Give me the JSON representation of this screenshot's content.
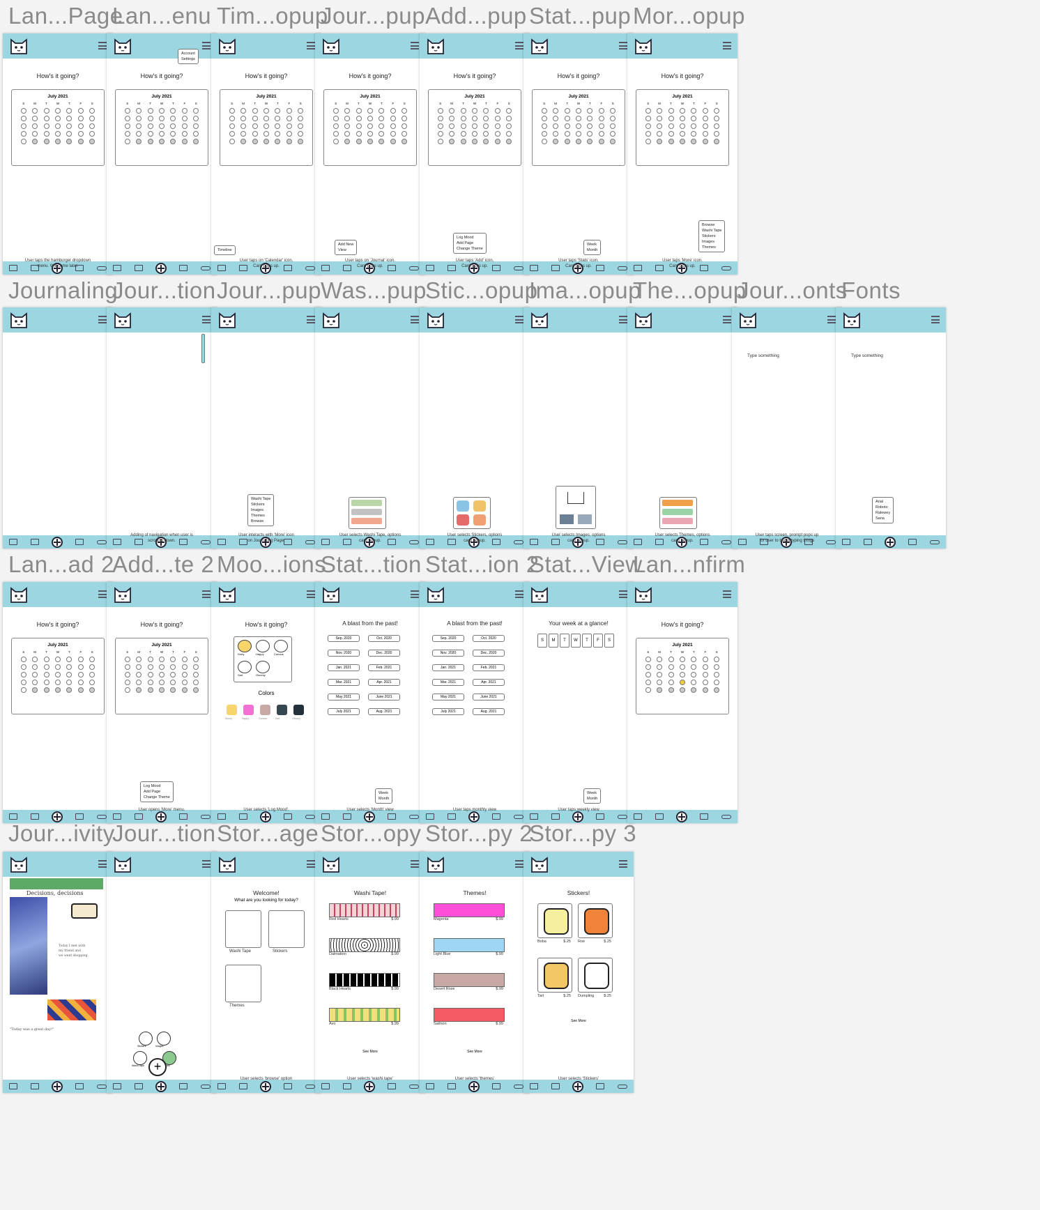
{
  "app": {
    "greeting": "How's it going?",
    "calendar_month": "July 2021",
    "type_placeholder": "Type something",
    "blast_title": "A blast from the past!",
    "week_title": "Your week at a glance!",
    "weekdays": [
      "S",
      "M",
      "T",
      "W",
      "T",
      "F",
      "S"
    ],
    "colors_label": "Colors"
  },
  "rows": [
    {
      "labels": [
        "Lan...Page",
        "Lan...enu",
        "Tim...opup",
        "Jour...pup",
        "Add...pup",
        "Stat...pup",
        "Mor...opup"
      ]
    },
    {
      "labels": [
        "Journaling",
        "Jour...tion",
        "Jour...pup",
        "Was...pup",
        "Stic...opup",
        "Ima...opup",
        "The...opup",
        "Jour...onts",
        "Fonts"
      ]
    },
    {
      "labels": [
        "Lan...ad 2",
        "Add...te 2",
        "Moo...ions",
        "Stat...tion",
        "Stat...ion 2",
        "Stat...View",
        "Lan...nfirm"
      ]
    },
    {
      "labels": [
        "Jour...ivity",
        "Jour...tion",
        "Stor...age",
        "Stor...opy",
        "Stor...py 2",
        "Stor...py 3"
      ]
    }
  ],
  "popups": {
    "account": "Account\nSettings",
    "timeline": "Timeline",
    "add_new": "Add New\nView",
    "add_menu": "Log Mood\nAdd Page\nChange Theme",
    "week_month": "Week\nMonth",
    "more_menu": "Browse\nWashi Tape\nStickers\nImages\nThemes",
    "journal_more": "Washi Tape\nStickers\nImages\nThemes\nBrowse",
    "fonts": "Arial\nRoboto\nRalewey\nSana"
  },
  "captions": {
    "r1": [
      "User taps the hamburger dropdown\nmenu. Will come later.",
      "",
      "User taps on 'Calendar' icon.\nCard pops up.",
      "User taps on 'Journal' icon.\nCard pops up.",
      "User taps 'Add' icon.\nCard pops up.",
      "User taps 'Stats' icon.\nCard pops up.",
      "User taps 'More' icon.\nCard pops up."
    ],
    "r2": [
      "",
      "Adding of navigation when user is\nscrolling down.",
      "User interacts with 'More' icon\non Journaling Page.",
      "User selects Washi Tape, options\ncard popup.",
      "User selects Stickers, options\ncard popup.",
      "User selects Images, options\ncard popup.",
      "User selects Themes, options\ncard popup.",
      "User taps screen, prompt pops up\nfor user to begin typing things",
      ""
    ],
    "r3": [
      "",
      "User opens 'More' menu.",
      "User selects 'Log Mood'.",
      "User selects 'Month' view",
      "User taps monthly view",
      "User taps weekly view",
      ""
    ],
    "r4": [
      "",
      "",
      "User selects 'browse' option",
      "User selects 'washi tape'",
      "User selects 'themes'",
      "User selects 'Stickers'"
    ]
  },
  "moods": {
    "faces": [
      "Sorry",
      "Happy",
      "Curious",
      "Sad",
      "Gloomy"
    ],
    "colors": [
      "#f8d56c",
      "#f470d4",
      "#c9a9a6",
      "#37474f",
      "#22313b"
    ],
    "color_labels": [
      "Sunny",
      "Happy",
      "Curious",
      "Sad",
      "Gloomy"
    ]
  },
  "months": [
    [
      "Sep. 2020",
      "Oct. 2020"
    ],
    [
      "Nov. 2020",
      "Dec. 2020"
    ],
    [
      "Jan. 2021",
      "Feb. 2021"
    ],
    [
      "Mar. 2021",
      "Apr. 2021"
    ],
    [
      "May 2021",
      "June 2021"
    ],
    [
      "July 2021",
      "Aug. 2021"
    ]
  ],
  "store": {
    "welcome": "Welcome!",
    "question": "What are you looking for today?",
    "cats": [
      "Washi Tape",
      "Stickers",
      "Themes"
    ],
    "see_more": "See More",
    "washi_title": "Washi Tape!",
    "washi": [
      {
        "name": "Red Hearts",
        "price": "$.99"
      },
      {
        "name": "Dalmation",
        "price": "$.99"
      },
      {
        "name": "Black Hearts",
        "price": "$.99"
      },
      {
        "name": "Avo",
        "price": "$.99"
      }
    ],
    "themes_title": "Themes!",
    "themes": [
      {
        "name": "Magenta",
        "price": "$.99",
        "color": "#ff4fd8"
      },
      {
        "name": "Light Blue",
        "price": "$.99",
        "color": "#9fd5f5"
      },
      {
        "name": "Desert Rose",
        "price": "$.99",
        "color": "#c9a9a6"
      },
      {
        "name": "Salmon",
        "price": "$.99",
        "color": "#f45b64"
      }
    ],
    "stickers_title": "Stickers!",
    "stickers": [
      {
        "name": "Boba",
        "price": "$.25"
      },
      {
        "name": "Roe",
        "price": "$.25"
      },
      {
        "name": "Tart",
        "price": "$.25"
      },
      {
        "name": "Dumpling",
        "price": "$.25"
      }
    ]
  },
  "journal": {
    "heading": "Decisions, decisions",
    "note": "Today I met with\nmy friend and\nwe went shopping.",
    "quote": "\"Today was a great day!\"",
    "wheel": [
      "Stickers",
      "Images",
      "Washi Tape",
      "Themes"
    ]
  }
}
